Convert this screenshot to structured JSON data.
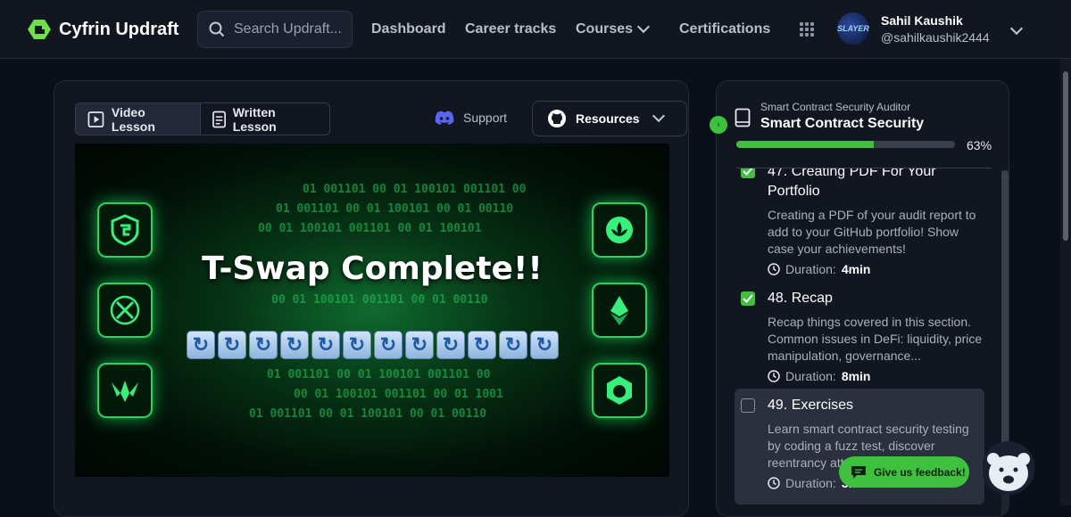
{
  "header": {
    "logo_text": "Cyfrin Updraft",
    "search_placeholder": "Search Updraft...",
    "nav": [
      "Dashboard",
      "Career tracks",
      "Courses",
      "Certifications"
    ],
    "user": {
      "name": "Sahil Kaushik",
      "handle": "@sahilkaushik2444",
      "avatar_text": "SLAYER"
    }
  },
  "lesson_tabs": {
    "video": "Video Lesson",
    "written": "Written Lesson",
    "active": "video"
  },
  "support_label": "Support",
  "resources_label": "Resources",
  "video": {
    "title": "T-Swap Complete!!",
    "emoji_count": 12,
    "emoji_icon": "repeat-emoji"
  },
  "course": {
    "track": "Smart Contract Security Auditor",
    "title": "Smart Contract Security",
    "progress_percent": 63,
    "progress_label": "63%"
  },
  "lessons": [
    {
      "title": "47. Creating PDF For Your Portfolio",
      "desc": "Creating a PDF of your audit report to add to your GitHub portfolio! Show case your achievements!",
      "duration_label": "Duration:",
      "duration": "4min",
      "completed": true
    },
    {
      "title": "48. Recap",
      "desc": "Recap things covered in this section. Common issues in DeFi: liquidity, price manipulation, governance...",
      "duration_label": "Duration:",
      "duration": "8min",
      "completed": true
    },
    {
      "title": "49. Exercises",
      "desc": "Learn smart contract security testing by coding a fuzz test, discover reentrancy att...",
      "duration_label": "Duration:",
      "duration": "3min",
      "completed": false
    }
  ],
  "feedback_label": "Give us feedback!",
  "colors": {
    "accent": "#3ec23e",
    "bg": "#0b0f17",
    "panel": "#121621"
  }
}
